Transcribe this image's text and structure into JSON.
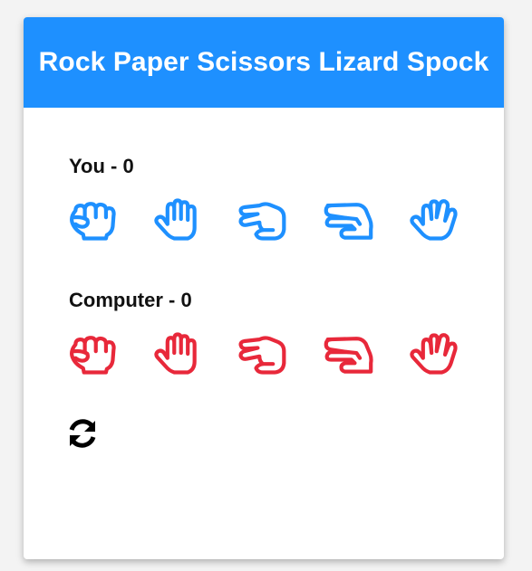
{
  "header": {
    "title": "Rock Paper Scissors Lizard Spock"
  },
  "player": {
    "name": "You",
    "separator": " - ",
    "score": "0"
  },
  "computer": {
    "name": "Computer",
    "separator": " - ",
    "score": "0"
  },
  "choices": [
    "rock",
    "paper",
    "scissors",
    "lizard",
    "spock"
  ],
  "colors": {
    "header_bg": "#1e90ff",
    "player_icons": "#1e90ff",
    "computer_icons": "#e8283a",
    "refresh_icon": "#000000"
  },
  "icons": {
    "rock": "fist-icon",
    "paper": "open-hand-icon",
    "scissors": "scissors-hand-icon",
    "lizard": "lizard-hand-icon",
    "spock": "spock-hand-icon",
    "refresh": "refresh-icon"
  }
}
